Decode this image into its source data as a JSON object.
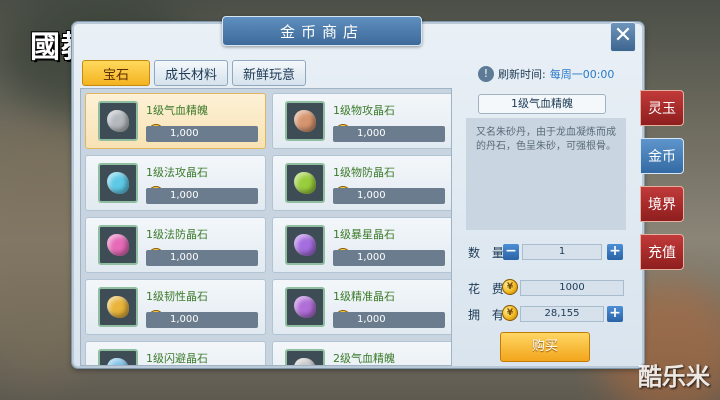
{
  "logo_text": "國教學院",
  "title": "金币商店",
  "close_label": "✕",
  "tabs": [
    {
      "label": "宝石",
      "active": true
    },
    {
      "label": "成长材料",
      "active": false
    },
    {
      "label": "新鲜玩意",
      "active": false
    }
  ],
  "refresh": {
    "label": "刷新时间:",
    "value": "每周一00:00"
  },
  "items": [
    {
      "name": "1级气血精魄",
      "price": "1,000",
      "gem_color": "#b4b9bd",
      "selected": true
    },
    {
      "name": "1级物攻晶石",
      "price": "1,000",
      "gem_color": "#d6956f",
      "selected": false
    },
    {
      "name": "1级法攻晶石",
      "price": "1,000",
      "gem_color": "#5ec9e6",
      "selected": false
    },
    {
      "name": "1级物防晶石",
      "price": "1,000",
      "gem_color": "#9acd3c",
      "selected": false
    },
    {
      "name": "1级法防晶石",
      "price": "1,000",
      "gem_color": "#e66ab8",
      "selected": false
    },
    {
      "name": "1级暴星晶石",
      "price": "1,000",
      "gem_color": "#a56de0",
      "selected": false
    },
    {
      "name": "1级韧性晶石",
      "price": "1,000",
      "gem_color": "#e8b43a",
      "selected": false
    },
    {
      "name": "1级精准晶石",
      "price": "1,000",
      "gem_color": "#b06ed8",
      "selected": false
    },
    {
      "name": "1级闪避晶石",
      "price": "",
      "gem_color": "#7ec0e8",
      "selected": false
    },
    {
      "name": "2级气血精魄",
      "price": "",
      "gem_color": "#c9c9c9",
      "selected": false
    }
  ],
  "detail": {
    "name": "1级气血精魄",
    "description": "又名朱砂丹，由于龙血凝炼而成的丹石，色呈朱砂，可强根骨。",
    "qty_label": "数 量",
    "qty_value": "1",
    "cost_label": "花 费",
    "cost_value": "1000",
    "own_label": "拥 有",
    "own_value": "28,155",
    "buy_label": "购买"
  },
  "side_tabs": [
    {
      "label": "灵玉",
      "active": false
    },
    {
      "label": "金币",
      "active": true
    },
    {
      "label": "境界",
      "active": false
    },
    {
      "label": "充值",
      "active": false
    }
  ],
  "watermark": "酷乐米",
  "colors": {
    "accent_blue": "#3d6a99",
    "gold": "#f4b321",
    "red_tab": "#a52a2a",
    "green_name": "#3b7a2a"
  }
}
